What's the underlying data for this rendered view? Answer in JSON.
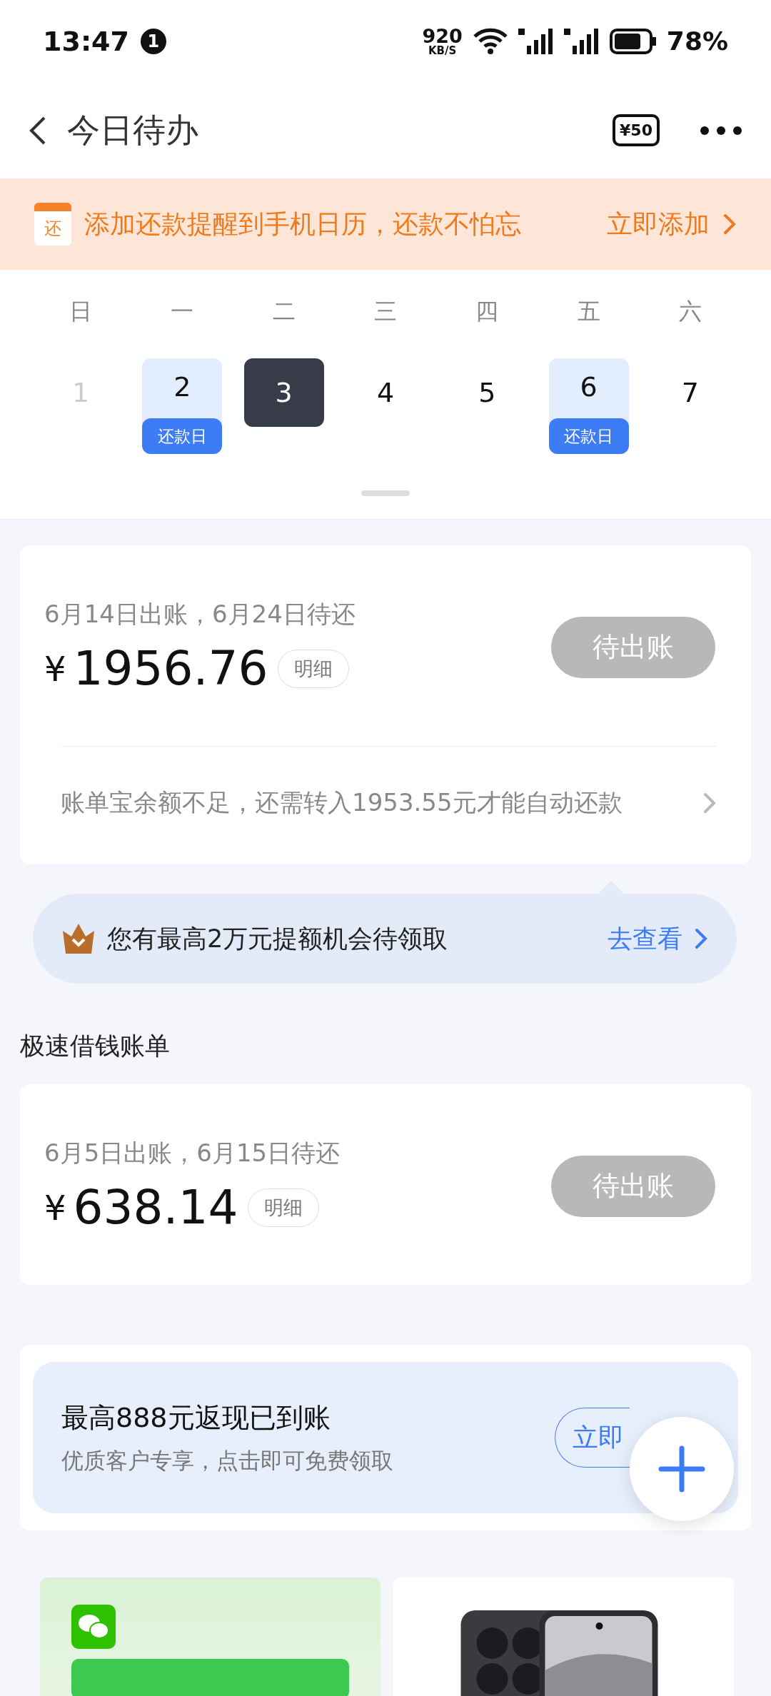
{
  "status_bar": {
    "time": "13:47",
    "notification_count": "1",
    "speed": "920",
    "speed_unit": "KB/S",
    "battery": "78%"
  },
  "header": {
    "title": "今日待办",
    "coupon": "¥50"
  },
  "reminder": {
    "icon_char": "还",
    "text": "添加还款提醒到手机日历，还款不怕忘",
    "action": "立即添加"
  },
  "calendar": {
    "weekdays": [
      "日",
      "一",
      "二",
      "三",
      "四",
      "五",
      "六"
    ],
    "days": [
      {
        "day": "1",
        "selected": false,
        "disabled": true
      },
      {
        "day": "2",
        "selected": false,
        "disabled": false,
        "due": "还款日"
      },
      {
        "day": "3",
        "selected": true,
        "disabled": false
      },
      {
        "day": "4",
        "selected": false,
        "disabled": false
      },
      {
        "day": "5",
        "selected": false,
        "disabled": false
      },
      {
        "day": "6",
        "selected": false,
        "disabled": false,
        "due": "还款日"
      },
      {
        "day": "7",
        "selected": false,
        "disabled": false
      }
    ]
  },
  "bill": {
    "dates": "6月14日出账，6月24日待还",
    "currency": "¥",
    "amount": "1956.76",
    "detail": "明细",
    "status": "待出账",
    "notice": "账单宝余额不足，还需转入1953.55元才能自动还款"
  },
  "credit_tip": {
    "text": "您有最高2万元提额机会待领取",
    "action": "去查看"
  },
  "loan_section": {
    "title": "极速借钱账单",
    "dates": "6月5日出账，6月15日待还",
    "currency": "¥",
    "amount": "638.14",
    "detail": "明细",
    "status": "待出账"
  },
  "cashback": {
    "title": "最高888元返现已到账",
    "subtitle": "优质客户专享，点击即可免费领取",
    "action": "立即"
  },
  "promos": [
    {
      "kind": "wechat"
    },
    {
      "kind": "picture"
    }
  ]
}
